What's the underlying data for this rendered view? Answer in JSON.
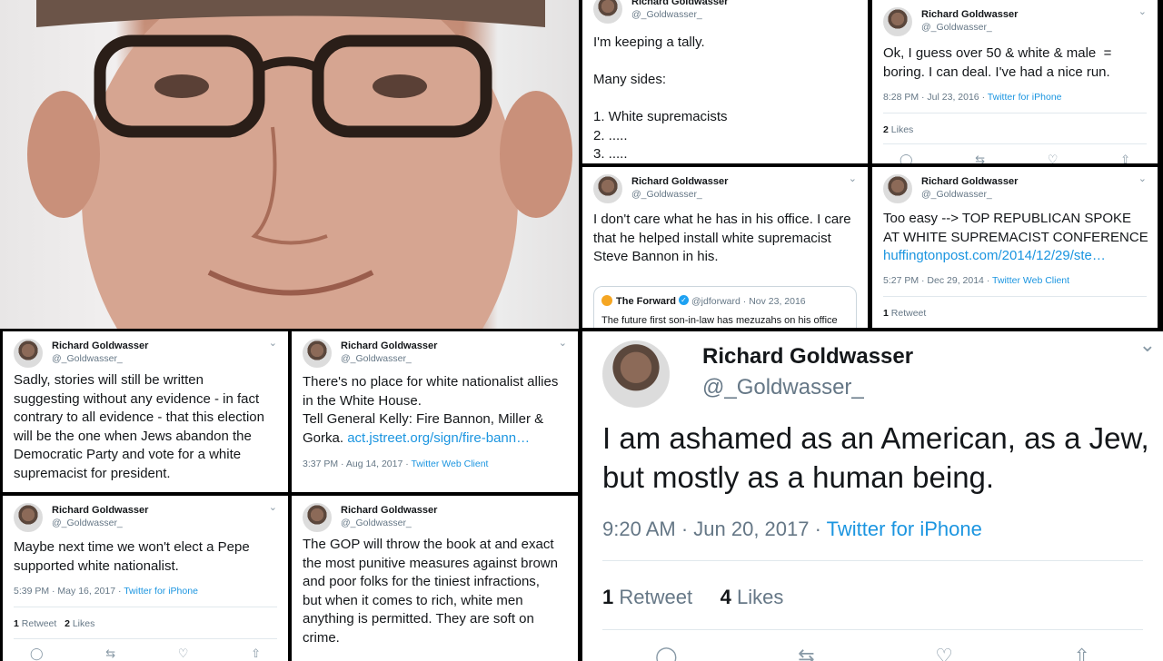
{
  "author": {
    "name": "Richard Goldwasser",
    "handle": "@_Goldwasser_"
  },
  "tweets": {
    "t1": {
      "name_cut": "Richard Goldwasser",
      "text": "I'm keeping a tally.\n\nMany sides:\n\n1. White supremacists\n2. .....\n3. ....."
    },
    "t2": {
      "text": "Ok, I guess over 50 & white & male  =\nboring. I can deal. I've had a nice run.",
      "time": "8:28 PM · Jul 23, 2016 · ",
      "client": "Twitter for iPhone",
      "likes_count": "2",
      "likes_label": "Likes"
    },
    "t3": {
      "text": "I don't care what he has in his office. I care\nthat he helped install white supremacist\nSteve Bannon in his.",
      "quote": {
        "name": "The Forward",
        "handle": "@jdforward · Nov 23, 2016",
        "text": "The future first son-in-law has mezuzahs on his office doorframe and a copy of Pirkei Avot in the reception"
      }
    },
    "t4": {
      "text": "Too easy --> TOP REPUBLICAN SPOKE\nAT WHITE SUPREMACIST CONFERENCE",
      "link": "huffingtonpost.com/2014/12/29/ste…",
      "time": "5:27 PM · Dec 29, 2014 · ",
      "client": "Twitter Web Client",
      "rt_count": "1",
      "rt_label": "Retweet"
    },
    "t5": {
      "text": "Sadly, stories will still be written\nsuggesting without any evidence - in fact\ncontrary to all evidence - that this election\nwill be the one when Jews abandon the\nDemocratic Party and vote for a white\nsupremacist for president."
    },
    "t6": {
      "text": "There's no place for white nationalist allies\nin the White House.\nTell General Kelly: Fire Bannon, Miller &\nGorka. ",
      "link": "act.jstreet.org/sign/fire-bann…",
      "time": "3:37 PM · Aug 14, 2017 · ",
      "client": "Twitter Web Client"
    },
    "t7": {
      "text": "Maybe next time we won't elect a Pepe\nsupported white nationalist.",
      "time": "5:39 PM · May 16, 2017 · ",
      "client": "Twitter for iPhone",
      "rt_count": "1",
      "rt_label": "Retweet",
      "likes_count": "2",
      "likes_label": "Likes"
    },
    "t8": {
      "text": "The GOP will throw the book at and exact\nthe most punitive measures against brown\nand poor folks for the tiniest infractions,\nbut when it comes to rich, white men\nanything is permitted. They are soft on\ncrime."
    },
    "big": {
      "text": "I am ashamed as an American, as a Jew,\nbut mostly as a human being.",
      "time": "9:20 AM · Jun 20, 2017 · ",
      "client": "Twitter for iPhone",
      "rt_count": "1",
      "rt_label": "Retweet",
      "likes_count": "4",
      "likes_label": "Likes"
    }
  },
  "icons": {
    "chevron": "chevron-down-icon",
    "reply": "reply-icon",
    "retweet": "retweet-icon",
    "like": "heart-icon",
    "share": "share-icon",
    "verified": "verified-icon"
  },
  "colors": {
    "link": "#1b95e0",
    "text": "#14171a",
    "muted": "#657786",
    "verified": "#1da1f2"
  }
}
